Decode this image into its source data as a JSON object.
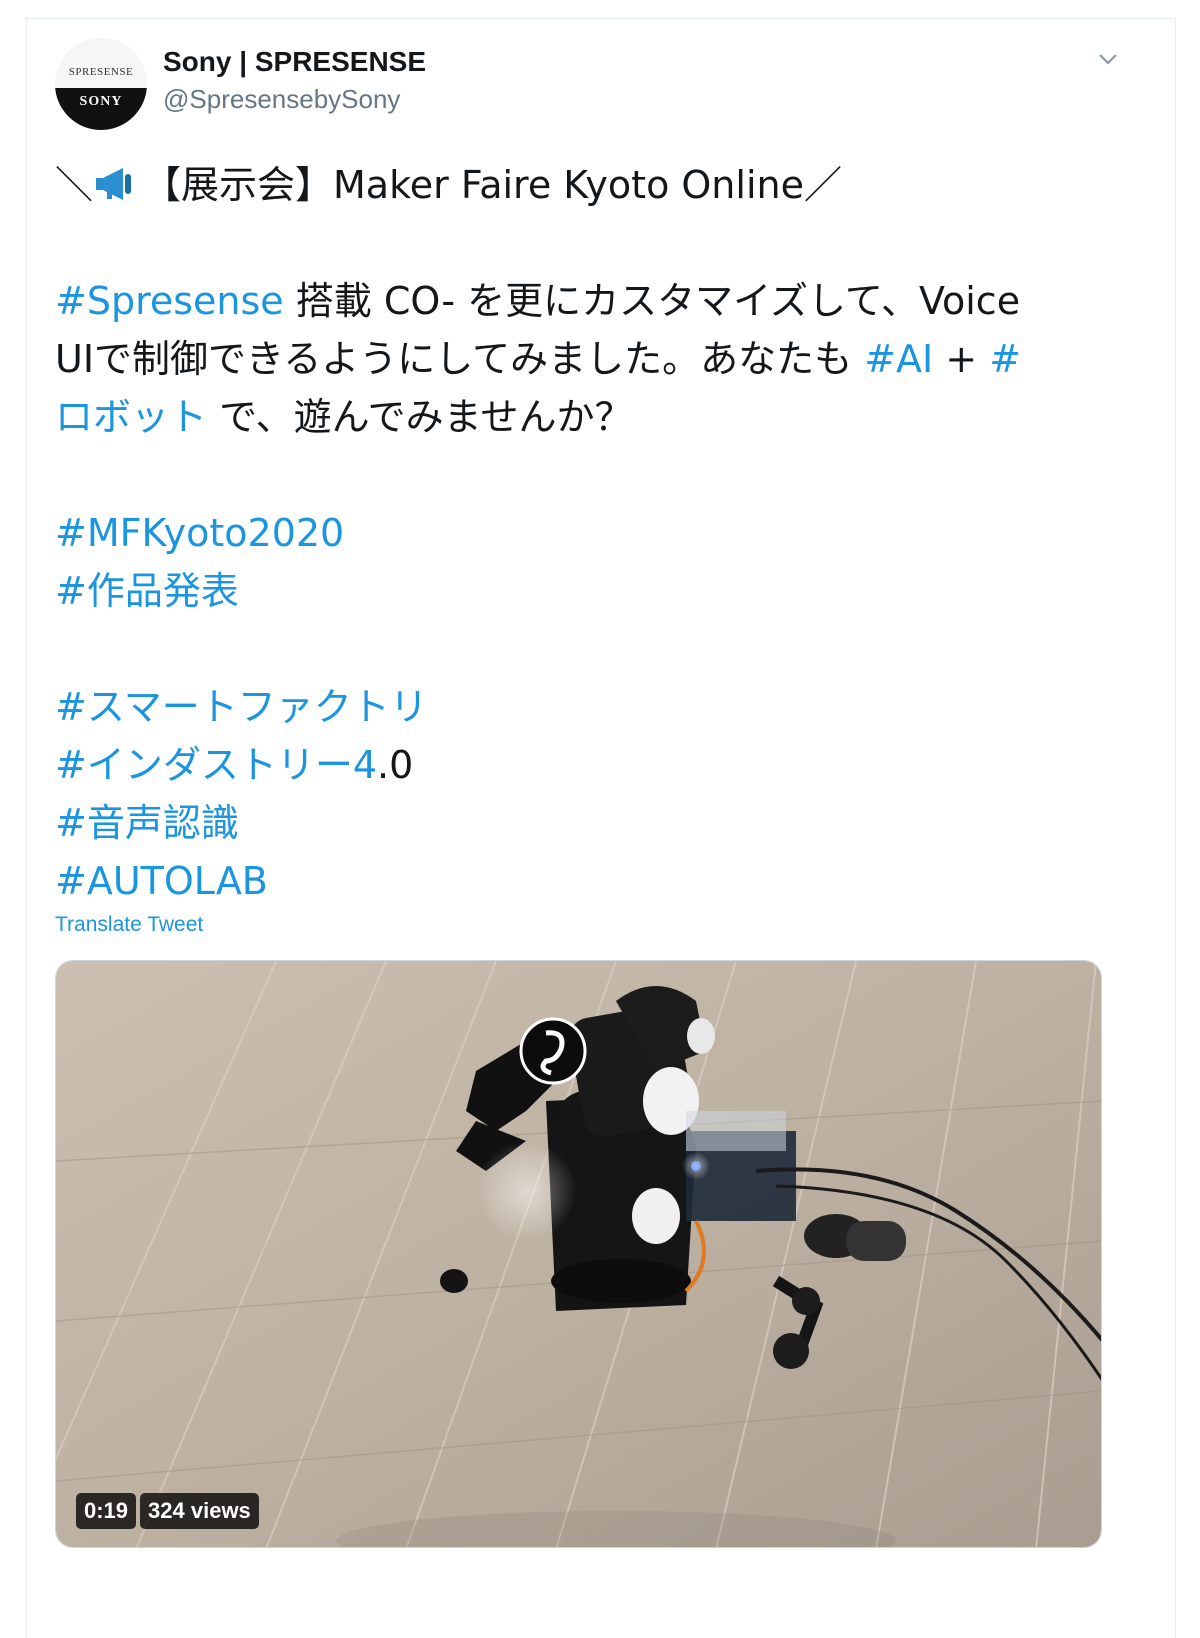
{
  "account": {
    "display_name": "Sony | SPRESENSE",
    "handle": "@SpresensebySony",
    "avatar_top_text": "SPRESENSE",
    "avatar_bottom_text": "SONY"
  },
  "tweet": {
    "line1_prefix": "＼",
    "line1_text": "【展示会】Maker Faire Kyoto Online／",
    "hashtag_spresense": "#Spresense",
    "line2_rest": " 搭載 CO- を更にカスタマイズして、Voice",
    "line3_text": "UIで制御できるようにしてみました。あなたも ",
    "hashtag_ai": "#AI",
    "plus": " + ",
    "hashtag_robot_start": "#",
    "hashtag_robot_end": "ロボット",
    "line4_rest": "  で、遊んでみませんか？",
    "hashtags": [
      "#MFKyoto2020",
      "#作品発表"
    ],
    "hashtags2_a": "#スマートファクトリ",
    "hashtag_industry": "#インダストリー4",
    "industry_suffix": ".0",
    "hashtag_voice": "#音声認識",
    "hashtag_autolab": "#AUTOLAB"
  },
  "translate_label": "Translate Tweet",
  "video": {
    "duration": "0:19",
    "views": "324 views"
  },
  "icons": {
    "menu": "chevron-down-icon",
    "megaphone": "megaphone-icon"
  },
  "colors": {
    "link": "#1b95e0",
    "text": "#14171a",
    "secondary": "#657786"
  }
}
